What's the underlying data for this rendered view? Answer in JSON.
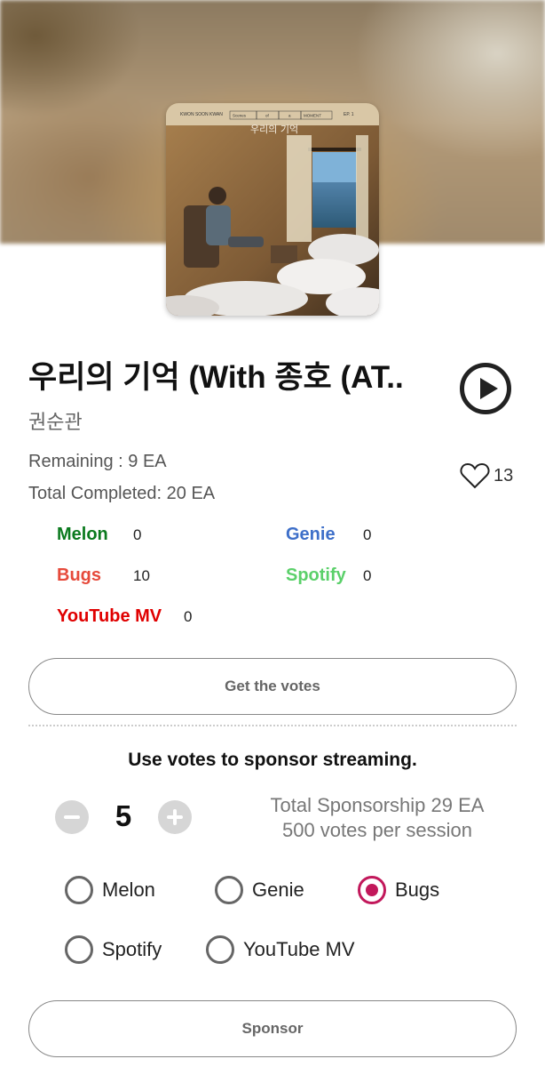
{
  "song": {
    "title": "우리의 기억 (With 종호 (AT..",
    "artist": "권순관"
  },
  "album_art": {
    "artist_text": "KWON SOON KWAN",
    "series_words": [
      "Scenes",
      "of",
      "a",
      "MOMENT"
    ],
    "title_text": "우리의 기억",
    "edition_text": "EP. 1"
  },
  "stats": {
    "remaining": "Remaining : 9 EA",
    "completed": "Total Completed: 20 EA",
    "likes": "13"
  },
  "platforms": [
    {
      "name": "Melon",
      "count": "0",
      "color": "#0b7a1e"
    },
    {
      "name": "Genie",
      "count": "0",
      "color": "#3e6fc9"
    },
    {
      "name": "Bugs",
      "count": "10",
      "color": "#e64a3b"
    },
    {
      "name": "Spotify",
      "count": "0",
      "color": "#5bd06a"
    },
    {
      "name": "YouTube MV",
      "count": "0",
      "color": "#e00000"
    }
  ],
  "get_votes_label": "Get the votes",
  "sponsor_section": {
    "heading": "Use votes to sponsor streaming.",
    "quantity": "5",
    "total": "Total Sponsorship 29 EA",
    "per_session": "500 votes per session",
    "options": [
      "Melon",
      "Genie",
      "Bugs",
      "Spotify",
      "YouTube MV"
    ],
    "selected": "Bugs",
    "accent": "#c2185b"
  },
  "sponsor_label": "Sponsor"
}
